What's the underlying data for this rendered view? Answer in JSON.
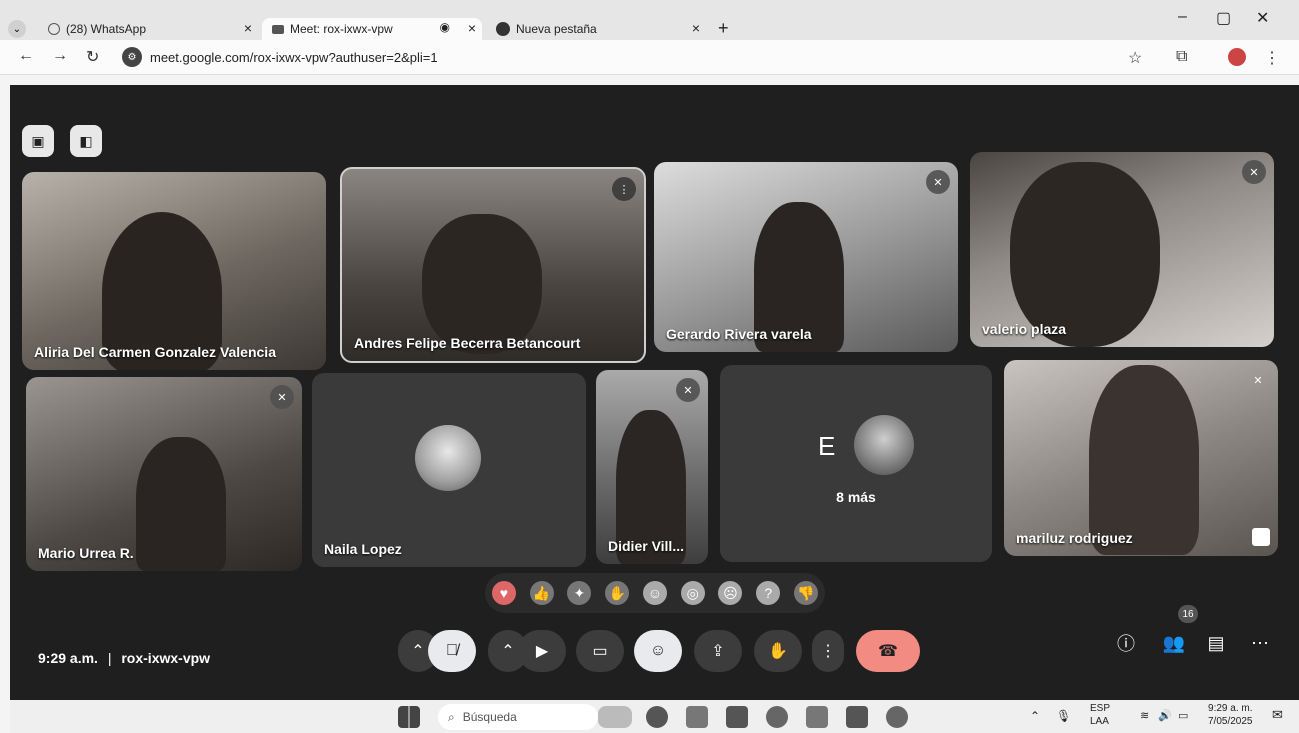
{
  "browser": {
    "tabs": [
      {
        "label": "(28) WhatsApp"
      },
      {
        "label": "Meet: rox-ixwx-vpw"
      },
      {
        "label": "Nueva pestaña"
      }
    ],
    "url": "meet.google.com/rox-ixwx-vpw?authuser=2&pli=1"
  },
  "meet": {
    "participants": [
      {
        "name": "Aliria Del Carmen Gonzalez Valencia"
      },
      {
        "name": "Andres Felipe Becerra Betancourt"
      },
      {
        "name": "Gerardo Rivera varela"
      },
      {
        "name": "valerio plaza"
      },
      {
        "name": "Mario Urrea R."
      },
      {
        "name": "Naila Lopez"
      },
      {
        "name": "Didier Vill..."
      },
      {
        "name": "mariluz rodriguez"
      }
    ],
    "more_tile": {
      "initial": "E",
      "label": "8 más"
    },
    "footer": {
      "time": "9:29 a.m.",
      "separator": "|",
      "code": "rox-ixwx-vpw"
    },
    "people_count": "16",
    "reactions": [
      "heart-icon",
      "thumbs-up-icon",
      "party-icon",
      "clap-icon",
      "laugh-icon",
      "surprised-icon",
      "sad-icon",
      "thinking-icon",
      "thumbs-down-icon"
    ]
  },
  "taskbar": {
    "search_placeholder": "Búsqueda",
    "lang_1": "ESP",
    "lang_2": "LAA",
    "clock_time": "9:29 a. m.",
    "clock_date": "7/05/2025"
  },
  "colors": {
    "end_call": "#f28b82",
    "meet_bg": "#1f1f1f",
    "active_btn": "#e8eaed"
  }
}
